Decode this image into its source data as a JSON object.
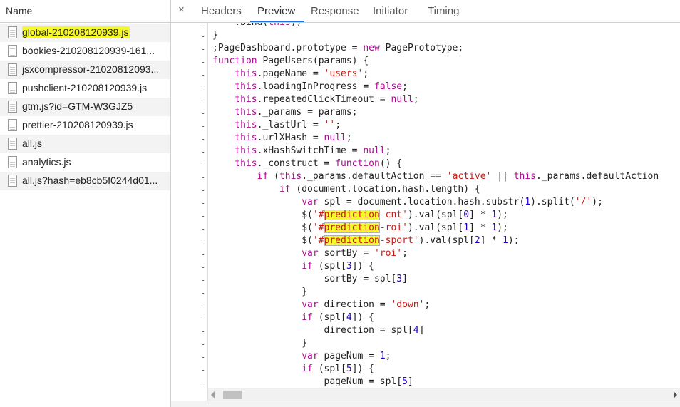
{
  "sidebar": {
    "header": "Name",
    "files": [
      {
        "name": "global-210208120939.js",
        "selected": true
      },
      {
        "name": "bookies-210208120939-161..."
      },
      {
        "name": "jsxcompressor-21020812093..."
      },
      {
        "name": "pushclient-210208120939.js"
      },
      {
        "name": "gtm.js?id=GTM-W3GJZ5"
      },
      {
        "name": "prettier-210208120939.js"
      },
      {
        "name": "all.js"
      },
      {
        "name": "analytics.js"
      },
      {
        "name": "all.js?hash=eb8cb5f0244d01..."
      }
    ]
  },
  "tabs": {
    "close": "×",
    "items": [
      "Headers",
      "Preview",
      "Response",
      "Initiator",
      "Timing"
    ],
    "active": "Preview"
  },
  "code": {
    "gutter_marker": "-",
    "lines": [
      "    .bind(this))",
      "}",
      ";PageDashboard.prototype = new PagePrototype;",
      "function PageUsers(params) {",
      "    this.pageName = 'users';",
      "    this.loadingInProgress = false;",
      "    this.repeatedClickTimeout = null;",
      "    this._params = params;",
      "    this._lastUrl = '';",
      "    this.urlXHash = null;",
      "    this.xHashSwitchTime = null;",
      "    this._construct = function() {",
      "        if (this._params.defaultAction == 'active' || this._params.defaultAction",
      "            if (document.location.hash.length) {",
      "                var spl = document.location.hash.substr(1).split('/');",
      "                $('#prediction-cnt').val(spl[0] * 1);",
      "                $('#prediction-roi').val(spl[1] * 1);",
      "                $('#prediction-sport').val(spl[2] * 1);",
      "                var sortBy = 'roi';",
      "                if (spl[3]) {",
      "                    sortBy = spl[3]",
      "                }",
      "                var direction = 'down';",
      "                if (spl[4]) {",
      "                    direction = spl[4]",
      "                }",
      "                var pageNum = 1;",
      "                if (spl[5]) {",
      "                    pageNum = spl[5]"
    ],
    "search_term": "prediction"
  },
  "colors": {
    "keyword": "#aa0d91",
    "string": "#c41a16",
    "number": "#1c00cf",
    "highlight": "#f6f82a",
    "accent": "#1a73e8"
  }
}
